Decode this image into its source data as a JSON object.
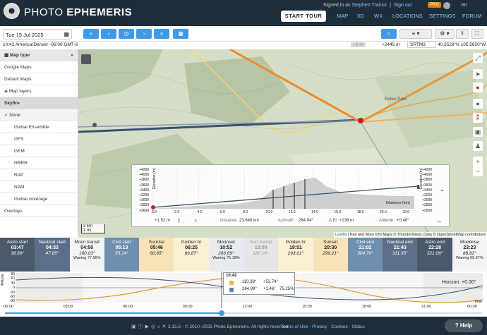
{
  "app": {
    "title_light": "PHOTO ",
    "title_bold": "EPHEMERIS",
    "signed_in_prefix": "Signed in as ",
    "user": "Stephen Trainor",
    "sign_out": "Sign out",
    "pro_badge": "PRO",
    "lang": "en",
    "start_tour": "START TOUR",
    "nav": [
      "MAP",
      "3D",
      "WX",
      "LOCATIONS",
      "SETTINGS",
      "FORUM"
    ]
  },
  "controls": {
    "date": "Tue 15 Jul 2025",
    "timezone": "10:42 America/Denver -06:00 GMT-6",
    "elev_small": "+0 m",
    "elevation": "+2445 m",
    "dem": "SRTM3",
    "coords": "40.3528°N 105.5820°W"
  },
  "sidebar": {
    "map_type": "Map type",
    "items": [
      "Google Maps",
      "Default Maps"
    ],
    "layers": "Map layers",
    "skyfire": "Skyfire",
    "options": [
      "None",
      "Global Ensemble",
      "GFS",
      "GEM",
      "HRRR",
      "RAP",
      "NAM",
      "Global coverage"
    ],
    "overlays": "Overlays"
  },
  "map": {
    "town": "Estes Park",
    "scale_km": "2 km",
    "scale_mi": "1 mi",
    "attribution_leaflet": "Leaflet",
    "attribution_rest": " | Key and More Info Maps © Thunderforest, Data © OpenStreetMap contributors"
  },
  "profile": {
    "y_ticks": [
      "+4200",
      "+4000",
      "+3800",
      "+3600",
      "+3400",
      "+3200",
      "+3000",
      "+2800",
      "+2600"
    ],
    "x_ticks": [
      "0.0",
      "2.0",
      "4.0",
      "6.0",
      "8.0",
      "10.0",
      "12.0",
      "14.0",
      "16.0",
      "18.0",
      "20.0",
      "22.0"
    ],
    "y_label": "Elevation (m)",
    "x_label": "Distance (km)",
    "offset": "+1.52 m",
    "distance_label": "Distance",
    "distance": "23.646 km",
    "azimuth_label": "Azimuth",
    "azimuth": "264.94°",
    "delta_el": "Δ El",
    "delta_el_value": "+236 m",
    "altitude_label": "Altitude",
    "altitude": "+0.48°"
  },
  "events": [
    {
      "name": "Astro start",
      "time": "03:47",
      "angle": "38.69°",
      "bg": "#4a5a6a",
      "fg": "#fff"
    },
    {
      "name": "Nautical start",
      "time": "04:33",
      "angle": "47.85°",
      "bg": "#5b7088",
      "fg": "#fff"
    },
    {
      "name": "Moon transit",
      "time": "04:50",
      "angle": "180.03°",
      "extra": "Waning 77.56%",
      "bg": "#f4f4f4",
      "fg": "#222"
    },
    {
      "name": "Civil start",
      "time": "05:13",
      "angle": "55.14°",
      "bg": "#6f8fb0",
      "fg": "#fff"
    },
    {
      "name": "Sunrise",
      "time": "05:46",
      "angle": "60.65°",
      "bg": "#f7e3b7",
      "fg": "#222"
    },
    {
      "name": "Golden hr",
      "time": "06:25",
      "angle": "66.87°",
      "bg": "#fbf0d4",
      "fg": "#222"
    },
    {
      "name": "Moonset",
      "time": "10:52",
      "angle": "266.69°",
      "extra": "Waning 75.18%",
      "bg": "#e8ecf1",
      "fg": "#222"
    },
    {
      "name": "Sun transit",
      "time": "13:08",
      "angle": "180.00°",
      "bg": "#e6e6e6",
      "fg": "#999"
    },
    {
      "name": "Golden hr",
      "time": "19:51",
      "angle": "293.01°",
      "bg": "#fbf0d4",
      "fg": "#222"
    },
    {
      "name": "Sunset",
      "time": "20:30",
      "angle": "299.21°",
      "bg": "#f7e3b7",
      "fg": "#222"
    },
    {
      "name": "Civil end",
      "time": "21:02",
      "angle": "304.70°",
      "bg": "#6f8fb0",
      "fg": "#fff"
    },
    {
      "name": "Nautical end",
      "time": "21:43",
      "angle": "311.95°",
      "bg": "#5b7088",
      "fg": "#fff"
    },
    {
      "name": "Astro end",
      "time": "22:28",
      "angle": "321.06°",
      "bg": "#4a5a6a",
      "fg": "#fff"
    },
    {
      "name": "Moonrise",
      "time": "23:23",
      "angle": "88.82°",
      "extra": "Waning 69.97%",
      "bg": "#f4f4f4",
      "fg": "#222"
    }
  ],
  "timeline": {
    "y_ticks": [
      "90",
      "60",
      "30",
      "0",
      "-30",
      "-60",
      "-90"
    ],
    "y_label": "Altitude",
    "x_ticks": [
      "00:00",
      "03:00",
      "06:00",
      "09:00",
      "12:00",
      "15:00",
      "18:00",
      "21:00",
      "00:00"
    ],
    "time_label": "Time",
    "popup_time": "10:42",
    "sun_az": "110.39°",
    "sun_alt": "+53.74°",
    "moon_az": "264.99°",
    "moon_alt": "+1.46°",
    "moon_illum": "75.25%",
    "horizon": "Horizon: +0.00°"
  },
  "footer": {
    "version": "3.15.6 - © 2010–2025 Photo Ephemeris. All rights reserved.",
    "links": [
      "Terms of Use",
      "Privacy",
      "Cookies",
      "Status"
    ],
    "help": "Help"
  }
}
